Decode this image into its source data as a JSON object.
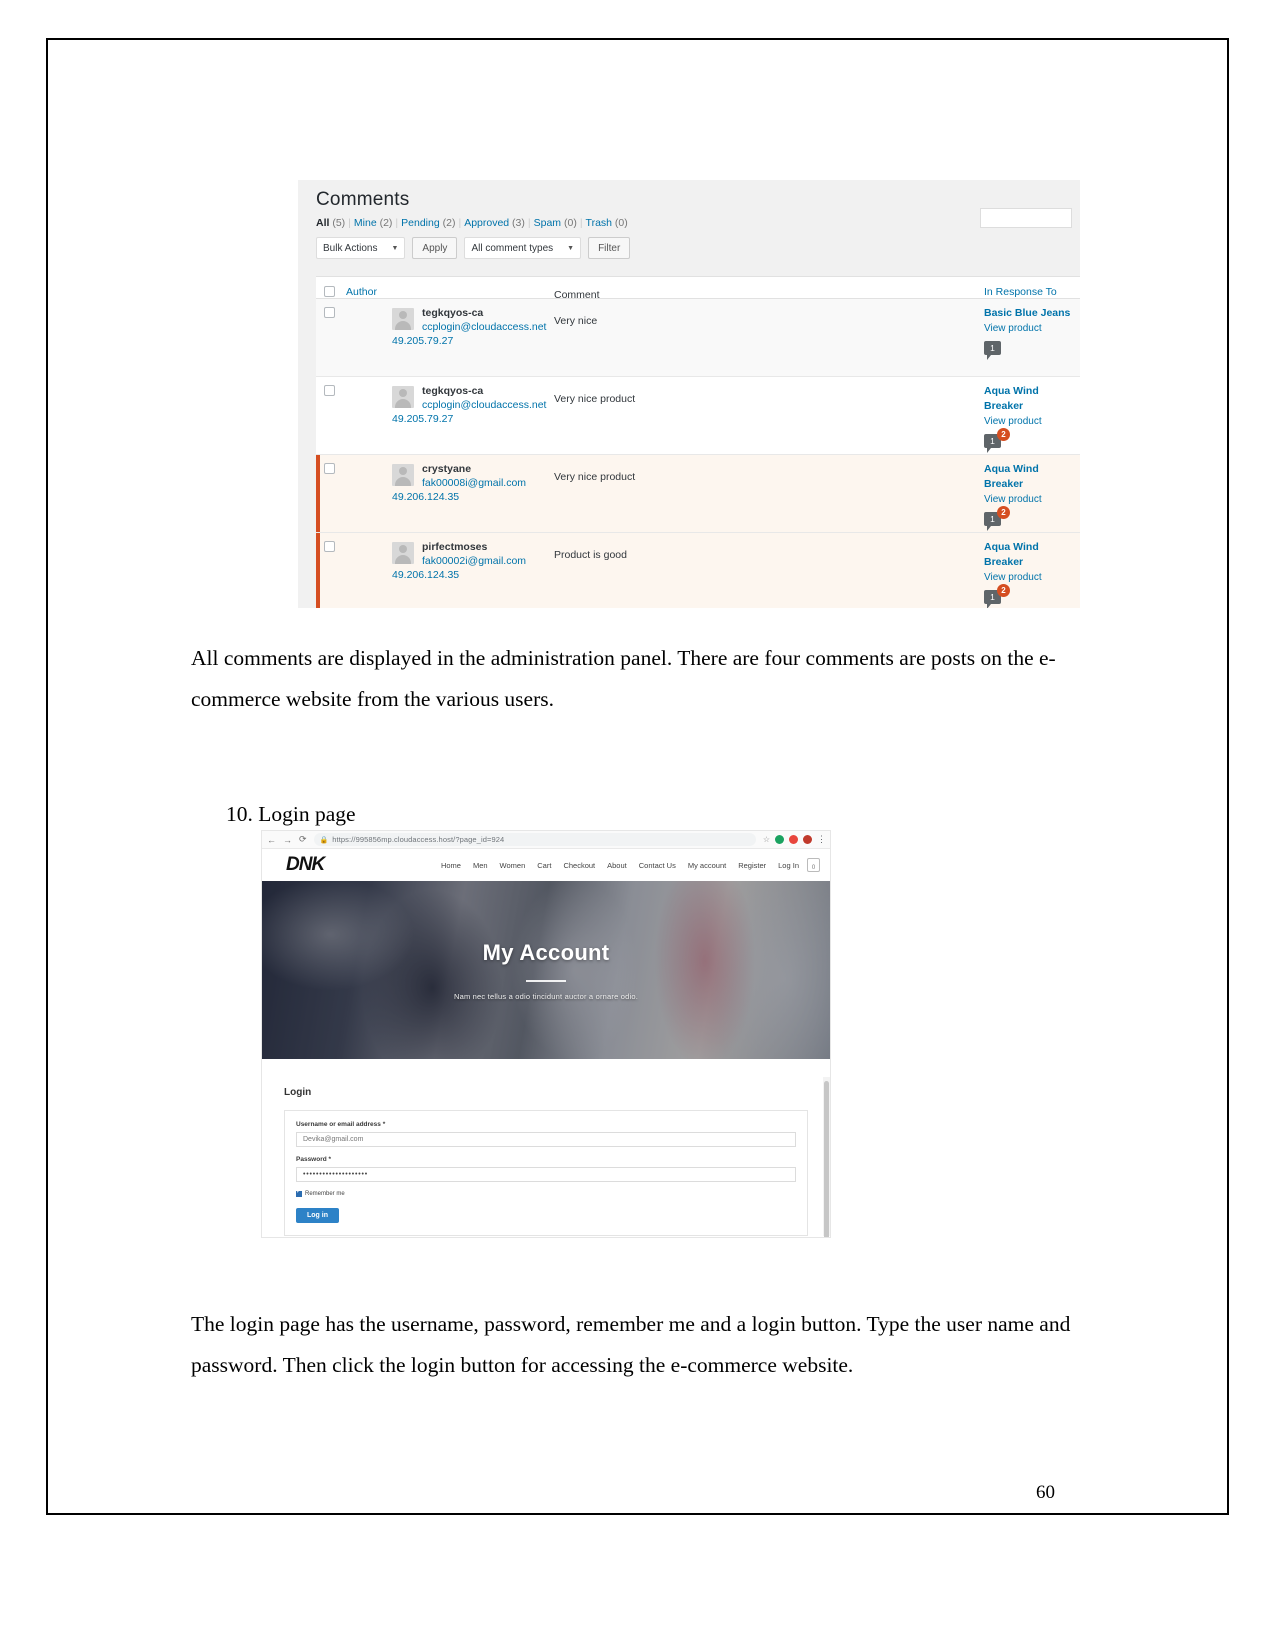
{
  "document": {
    "page_number": "60",
    "paragraph_1": "All comments are displayed in the administration panel. There are four comments are posts on the e-commerce website from the various users.",
    "heading_login": "10. Login page",
    "paragraph_2": "The login page has the username, password, remember me and a login button. Type the user name and password. Then click the login button for accessing the e-commerce website."
  },
  "wp_comments": {
    "title": "Comments",
    "filters": [
      {
        "label": "All",
        "count": "(5)",
        "current": true
      },
      {
        "label": "Mine",
        "count": "(2)",
        "current": false
      },
      {
        "label": "Pending",
        "count": "(2)",
        "current": false
      },
      {
        "label": "Approved",
        "count": "(3)",
        "current": false
      },
      {
        "label": "Spam",
        "count": "(0)",
        "current": false
      },
      {
        "label": "Trash",
        "count": "(0)",
        "current": false
      }
    ],
    "search_value": "",
    "bulk_actions_label": "Bulk Actions",
    "apply_label": "Apply",
    "comment_types_label": "All comment types",
    "filter_label": "Filter",
    "columns": {
      "author": "Author",
      "comment": "Comment",
      "in_response_to": "In Response To"
    },
    "view_product_label": "View product",
    "rows": [
      {
        "author": "tegkqyos-ca",
        "email": "ccplogin@cloudaccess.net",
        "ip": "49.205.79.27",
        "comment": "Very nice",
        "product": "Basic Blue Jeans",
        "bubble_count": "1",
        "pending_count": "",
        "pending": false,
        "alt": true
      },
      {
        "author": "tegkqyos-ca",
        "email": "ccplogin@cloudaccess.net",
        "ip": "49.205.79.27",
        "comment": "Very nice product",
        "product": "Aqua Wind Breaker",
        "bubble_count": "1",
        "pending_count": "2",
        "pending": false,
        "alt": false
      },
      {
        "author": "crystyane",
        "email": "fak00008i@gmail.com",
        "ip": "49.206.124.35",
        "comment": "Very nice product",
        "product": "Aqua Wind Breaker",
        "bubble_count": "1",
        "pending_count": "2",
        "pending": true,
        "alt": false
      },
      {
        "author": "pirfectmoses",
        "email": "fak00002i@gmail.com",
        "ip": "49.206.124.35",
        "comment": "Product is good",
        "product": "Aqua Wind Breaker",
        "bubble_count": "1",
        "pending_count": "2",
        "pending": true,
        "alt": false
      }
    ]
  },
  "browser": {
    "back_icon": "←",
    "forward_icon": "→",
    "reload_icon": "⟳",
    "lock_icon": "🔒",
    "url": "https://995856mp.cloudaccess.host/?page_id=924",
    "star_icon": "☆",
    "kebab_icon": "⋮",
    "ext_colors": [
      "#1aa260",
      "#e8453c",
      "#c0392b"
    ]
  },
  "site": {
    "logo": "DNK",
    "nav": [
      "Home",
      "Men",
      "Women",
      "Cart",
      "Checkout",
      "About",
      "Contact Us",
      "My account",
      "Register",
      "Log In"
    ],
    "cart_count": "0",
    "hero_title": "My Account",
    "hero_subtitle": "Nam nec tellus a odio tincidunt auctor a ornare odio."
  },
  "login_form": {
    "heading": "Login",
    "username_label": "Username or email address",
    "username_value": "Devika@gmail.com",
    "password_label": "Password",
    "password_value": "••••••••••••••••••••",
    "remember_label": "Remember me",
    "submit_label": "Log in",
    "required_mark": "*",
    "accent": "#2d82c7"
  }
}
